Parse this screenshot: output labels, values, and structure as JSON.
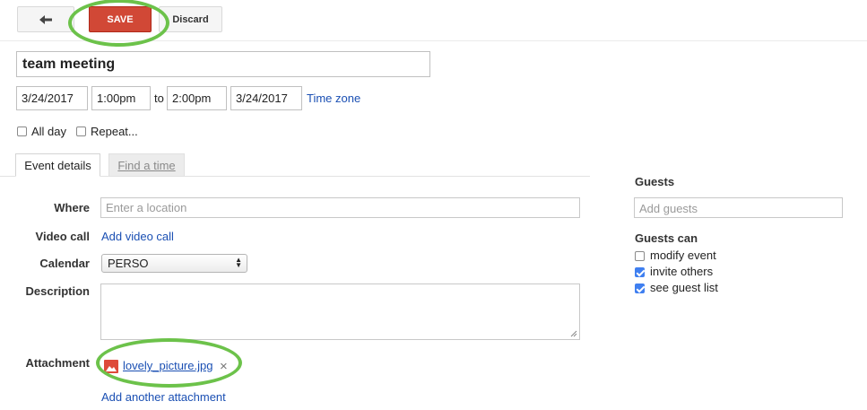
{
  "toolbar": {
    "back_icon": "back-arrow-icon",
    "save_label": "SAVE",
    "discard_label": "Discard"
  },
  "event": {
    "title": "team meeting",
    "start_date": "3/24/2017",
    "start_time": "1:00pm",
    "to_label": "to",
    "end_time": "2:00pm",
    "end_date": "3/24/2017",
    "timezone_link": "Time zone",
    "all_day_label": "All day",
    "all_day_checked": false,
    "repeat_label": "Repeat...",
    "repeat_checked": false
  },
  "tabs": [
    {
      "label": "Event details",
      "active": true
    },
    {
      "label": "Find a time",
      "active": false
    }
  ],
  "details": {
    "where_label": "Where",
    "where_placeholder": "Enter a location",
    "video_label": "Video call",
    "video_link": "Add video call",
    "calendar_label": "Calendar",
    "calendar_value": "PERSO",
    "description_label": "Description",
    "description_value": "",
    "attachment_label": "Attachment",
    "attachment_file": "lovely_picture.jpg",
    "attachment_icon": "image-file-icon",
    "remove_icon": "close-icon",
    "remove_glyph": "×",
    "add_attachment_link": "Add another attachment"
  },
  "guests": {
    "heading": "Guests",
    "add_placeholder": "Add guests",
    "can_heading": "Guests can",
    "permissions": [
      {
        "label": "modify event",
        "checked": false
      },
      {
        "label": "invite others",
        "checked": true
      },
      {
        "label": "see guest list",
        "checked": true
      }
    ]
  },
  "colors": {
    "save_button": "#d14836",
    "link": "#1a4fb3",
    "checkbox_checked": "#3f7ff0",
    "highlight_ring": "#6cc24a"
  }
}
